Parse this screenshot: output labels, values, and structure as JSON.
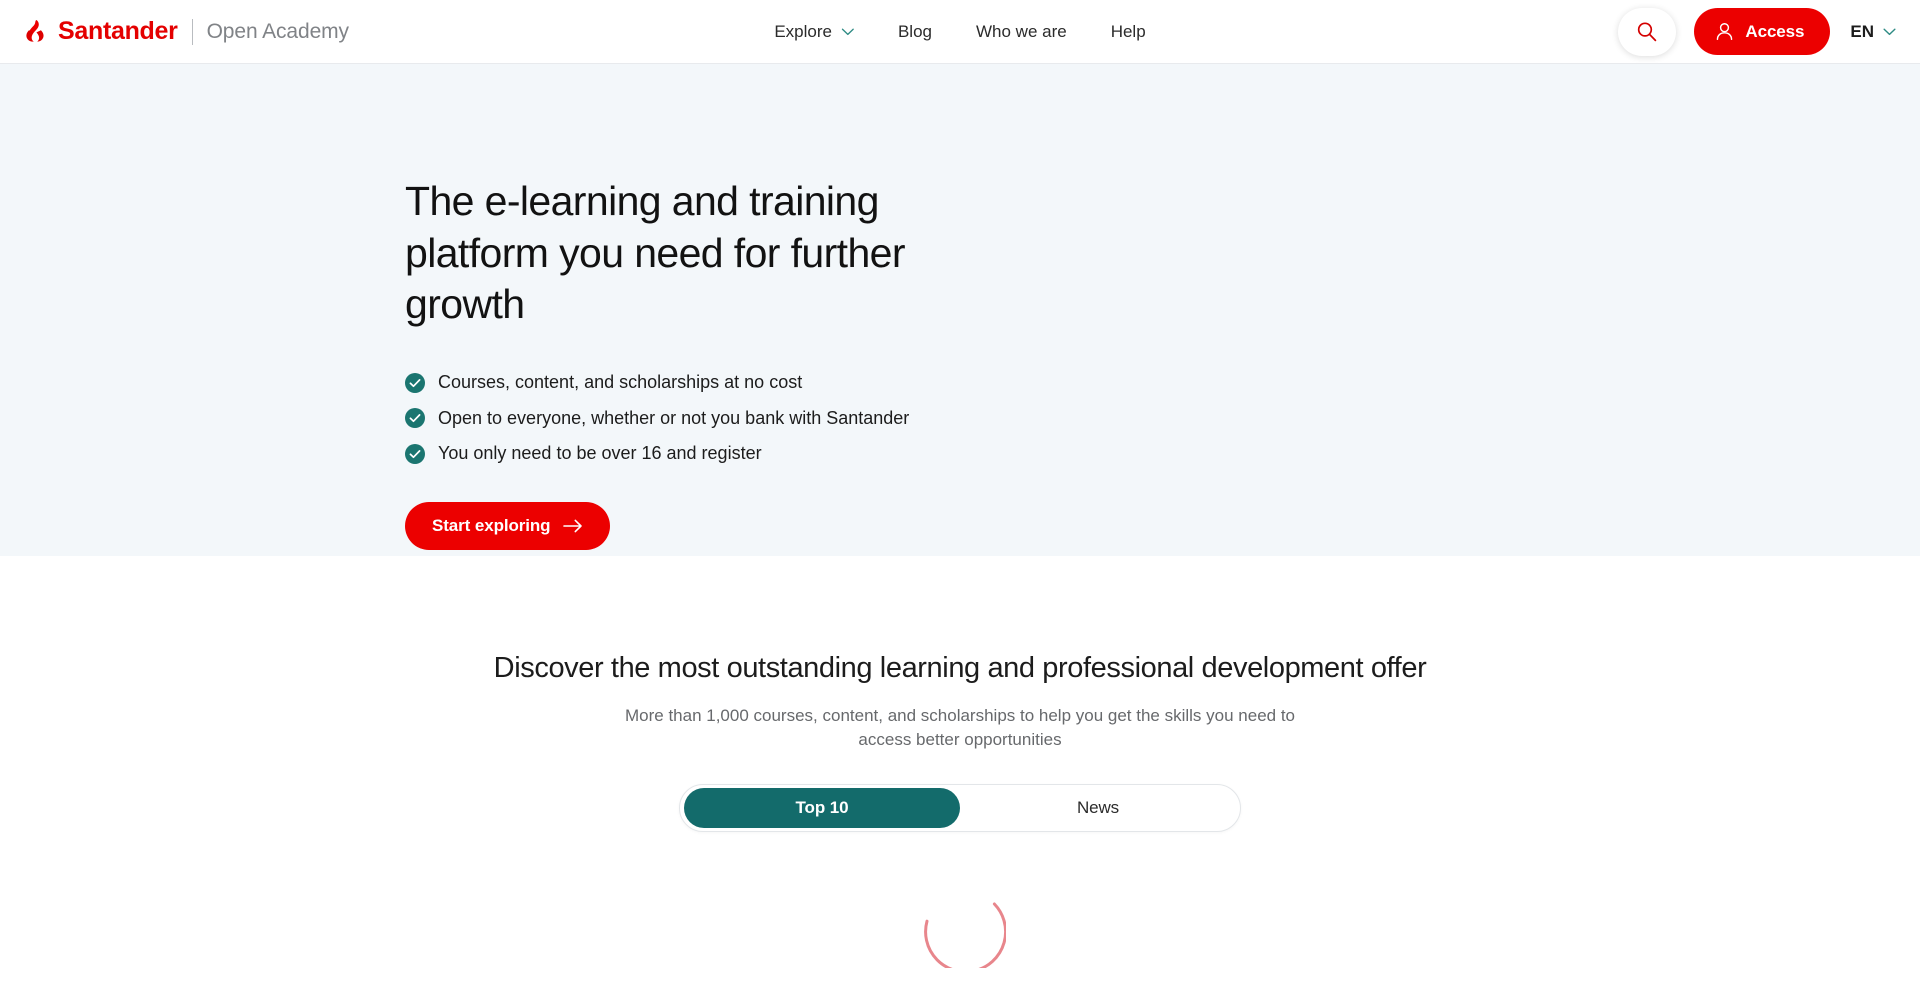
{
  "colors": {
    "brand_red": "#ec0000",
    "logo_red": "#e40000",
    "teal": "#136b6b",
    "check_teal": "#1a7570",
    "chevron_teal": "#2e8b84",
    "hero_bg": "#f3f7fa",
    "spinner_pink": "#e8868c",
    "text_dark": "#1c1c1c",
    "text_muted": "#67696c"
  },
  "header": {
    "brand": {
      "flame_icon": "santander-flame-icon",
      "name": "Santander",
      "divider": "|",
      "sub": "Open Academy"
    },
    "nav": [
      {
        "label": "Explore",
        "has_chevron": true,
        "icon": "chevron-down-icon"
      },
      {
        "label": "Blog",
        "has_chevron": false
      },
      {
        "label": "Who we are",
        "has_chevron": false
      },
      {
        "label": "Help",
        "has_chevron": false
      }
    ],
    "search": {
      "icon": "search-icon",
      "aria": "Search"
    },
    "access": {
      "label": "Access",
      "icon": "user-icon"
    },
    "language": {
      "label": "EN",
      "icon": "chevron-down-icon"
    }
  },
  "hero": {
    "title": "The e-learning and training platform you need for further growth",
    "bullets": [
      "Courses, content, and scholarships at no cost",
      "Open to everyone, whether or not you bank with Santander",
      "You only need to be over 16 and register"
    ],
    "bullet_icon": "check-circle-icon",
    "cta": {
      "label": "Start exploring",
      "icon": "arrow-right-icon"
    }
  },
  "discover": {
    "title": "Discover the most outstanding learning and professional development offer",
    "subtitle": "More than 1,000 courses, content, and scholarships to help you get the skills you need to access better opportunities",
    "tabs": [
      {
        "label": "Top 10",
        "active": true
      },
      {
        "label": "News",
        "active": false
      }
    ],
    "loading": {
      "icon": "loading-spinner-icon",
      "state": "loading"
    }
  }
}
